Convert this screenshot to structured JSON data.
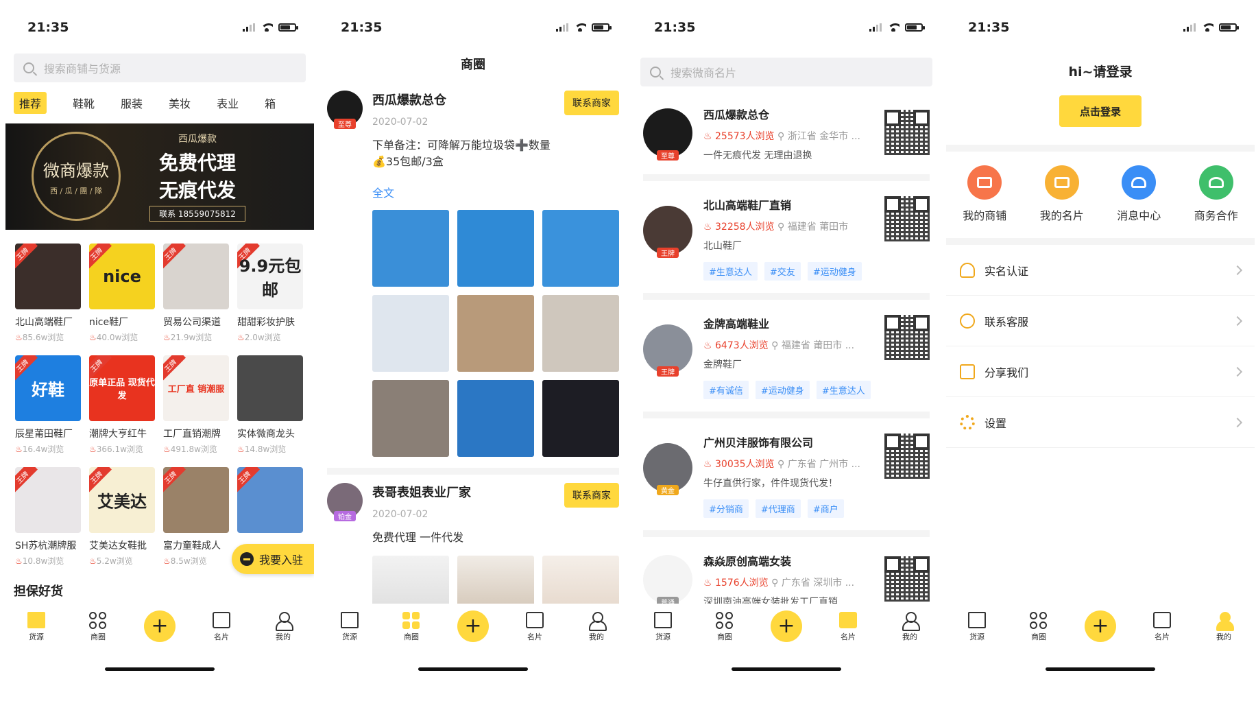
{
  "status": {
    "time": "21:35"
  },
  "screen1": {
    "search_placeholder": "搜索商铺与货源",
    "tabs": [
      "推荐",
      "鞋靴",
      "服装",
      "美妆",
      "表业",
      "箱"
    ],
    "banner": {
      "ring_text": "微商爆款",
      "ring_sub": "西 / 瓜 / 團 / 隊",
      "small": "西瓜爆款",
      "line1": "免费代理",
      "line2": "无痕代发",
      "contact": "联系 18559075812"
    },
    "items": [
      {
        "name": "北山高端鞋厂",
        "views": "85.6w浏览",
        "tag": "王牌",
        "img_text": "",
        "bg": "#3b2e2a"
      },
      {
        "name": "nice鞋厂",
        "views": "40.0w浏览",
        "tag": "王牌",
        "img_text": "nice",
        "bg": "#f5d21f"
      },
      {
        "name": "贸易公司渠道",
        "views": "21.9w浏览",
        "tag": "王牌",
        "img_text": "",
        "bg": "#d9d4cf"
      },
      {
        "name": "甜甜彩妆护肤",
        "views": "2.0w浏览",
        "tag": "王牌",
        "img_text": "9.9元包邮",
        "bg": "#f3f3f3"
      },
      {
        "name": "辰星莆田鞋厂",
        "views": "16.4w浏览",
        "tag": "王牌",
        "img_text": "好鞋",
        "bg": "#1e7fe0"
      },
      {
        "name": "潮牌大亨红牛",
        "views": "366.1w浏览",
        "tag": "王牌",
        "img_text": "原单正品 现货代发",
        "bg": "#e8331f"
      },
      {
        "name": "工厂直销潮牌",
        "views": "491.8w浏览",
        "tag": "王牌",
        "img_text": "工厂直 销潮服",
        "bg": "#f4f0ec"
      },
      {
        "name": "实体微商龙头",
        "views": "14.8w浏览",
        "tag": "",
        "img_text": "",
        "bg": "#4a4a4a"
      },
      {
        "name": "SH苏杭潮牌服",
        "views": "10.8w浏览",
        "tag": "王牌",
        "img_text": "",
        "bg": "#e9e6e8"
      },
      {
        "name": "艾美达女鞋批",
        "views": "5.2w浏览",
        "tag": "王牌",
        "img_text": "艾美达",
        "bg": "#f7efd3"
      },
      {
        "name": "富力童鞋成人",
        "views": "8.5w浏览",
        "tag": "王牌",
        "img_text": "",
        "bg": "#9a8268"
      },
      {
        "name": "",
        "views": "",
        "tag": "王牌",
        "img_text": "",
        "bg": "#5a8fd0"
      }
    ],
    "section_title": "担保好货",
    "join_label": "我要入驻"
  },
  "screen2": {
    "title": "商圈",
    "posts": [
      {
        "name": "西瓜爆款总仓",
        "date": "2020-07-02",
        "badge": "至尊",
        "badge_color": "#e8412c",
        "contact": "联系商家",
        "text": [
          "下单备注：可降解万能垃圾袋➕数量",
          "💰35包邮/3盒"
        ],
        "fulltext": "全文"
      },
      {
        "name": "表哥表姐表业厂家",
        "date": "2020-07-02",
        "badge": "铂金",
        "badge_color": "#b66ae0",
        "contact": "联系商家",
        "text": [
          "免费代理    一件代发"
        ]
      }
    ],
    "photos": [
      "#3a8fd8",
      "#2f8ad6",
      "#3a92dc",
      "#dfe6ee",
      "#b89a7a",
      "#cfc7bd",
      "#8a7f76",
      "#2b77c4",
      "#1d1d24"
    ]
  },
  "screen3": {
    "search_placeholder": "搜索微商名片",
    "cards": [
      {
        "name": "西瓜爆款总仓",
        "views": "25573人浏览",
        "loc": "浙江省 金华市 ...",
        "desc": "一件无痕代发 无理由退换",
        "tags": [],
        "badge": "至尊",
        "badge_color": "#e8412c"
      },
      {
        "name": "北山高端鞋厂直销",
        "views": "32258人浏览",
        "loc": "福建省 莆田市",
        "desc": "北山鞋厂",
        "tags": [
          "#生意达人",
          "#交友",
          "#运动健身"
        ],
        "badge": "王牌",
        "badge_color": "#e8412c"
      },
      {
        "name": "金牌高端鞋业",
        "views": "6473人浏览",
        "loc": "福建省 莆田市 ...",
        "desc": "金牌鞋厂",
        "tags": [
          "#有诚信",
          "#运动健身",
          "#生意达人"
        ],
        "badge": "王牌",
        "badge_color": "#e8412c"
      },
      {
        "name": "广州贝沣服饰有限公司",
        "views": "30035人浏览",
        "loc": "广东省 广州市 ...",
        "desc": "牛仔直供行家，件件现货代发！",
        "tags": [
          "#分销商",
          "#代理商",
          "#商户"
        ],
        "badge": "黄金",
        "badge_color": "#f0a81c"
      },
      {
        "name": "森焱原创高端女装",
        "views": "1576人浏览",
        "loc": "广东省 深圳市 ...",
        "desc": "深圳南油高端女装批发工厂直销",
        "tags": [],
        "badge": "普通",
        "badge_color": "#999999"
      }
    ]
  },
  "screen4": {
    "greeting": "hi~请登录",
    "login_label": "点击登录",
    "quick": [
      {
        "label": "我的商铺",
        "color": "#f7754a"
      },
      {
        "label": "我的名片",
        "color": "#f8b134"
      },
      {
        "label": "消息中心",
        "color": "#3a8ef6"
      },
      {
        "label": "商务合作",
        "color": "#3fbf6b"
      }
    ],
    "menu": [
      "实名认证",
      "联系客服",
      "分享我们",
      "设置"
    ]
  },
  "tabbar": {
    "labels": [
      "货源",
      "商圈",
      "名片",
      "我的"
    ]
  }
}
